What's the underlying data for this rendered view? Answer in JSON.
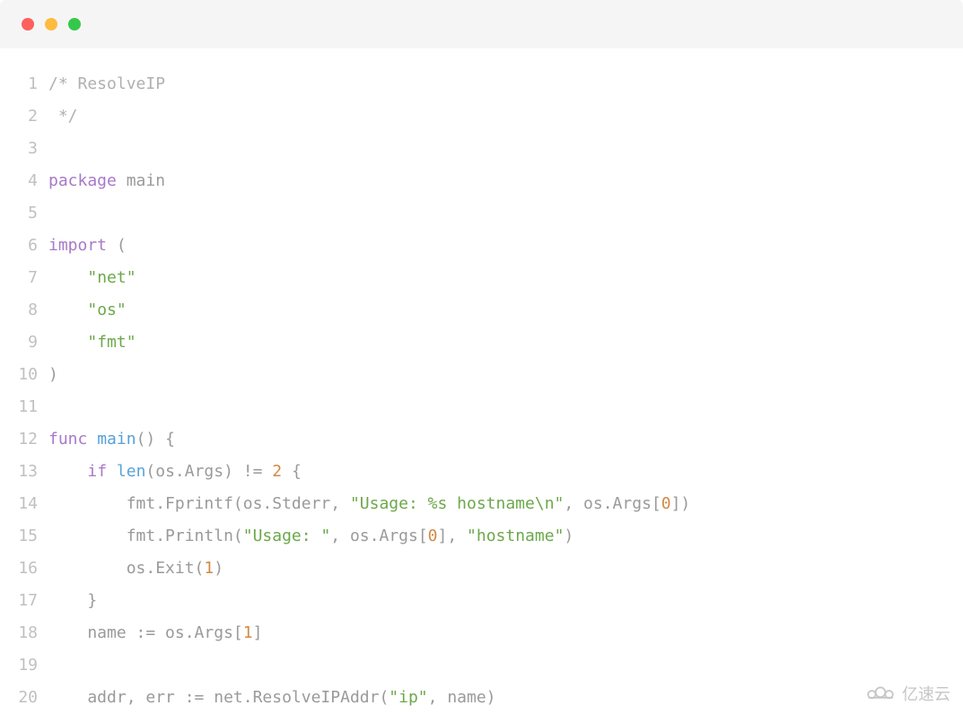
{
  "window": {
    "traffic_lights": [
      "red",
      "yellow",
      "green"
    ]
  },
  "code": {
    "language": "go",
    "lines": [
      {
        "n": 1,
        "tokens": [
          [
            "comment",
            "/* ResolveIP"
          ]
        ]
      },
      {
        "n": 2,
        "tokens": [
          [
            "comment",
            " */"
          ]
        ]
      },
      {
        "n": 3,
        "tokens": []
      },
      {
        "n": 4,
        "tokens": [
          [
            "keyword",
            "package"
          ],
          [
            "ident",
            " main"
          ]
        ]
      },
      {
        "n": 5,
        "tokens": []
      },
      {
        "n": 6,
        "tokens": [
          [
            "keyword",
            "import"
          ],
          [
            "punct",
            " ("
          ]
        ]
      },
      {
        "n": 7,
        "tokens": [
          [
            "ident",
            "    "
          ],
          [
            "string",
            "\"net\""
          ]
        ]
      },
      {
        "n": 8,
        "tokens": [
          [
            "ident",
            "    "
          ],
          [
            "string",
            "\"os\""
          ]
        ]
      },
      {
        "n": 9,
        "tokens": [
          [
            "ident",
            "    "
          ],
          [
            "string",
            "\"fmt\""
          ]
        ]
      },
      {
        "n": 10,
        "tokens": [
          [
            "punct",
            ")"
          ]
        ]
      },
      {
        "n": 11,
        "tokens": []
      },
      {
        "n": 12,
        "tokens": [
          [
            "keyword",
            "func"
          ],
          [
            "ident",
            " "
          ],
          [
            "fn",
            "main"
          ],
          [
            "punct",
            "()"
          ],
          [
            "punct",
            " {"
          ]
        ]
      },
      {
        "n": 13,
        "tokens": [
          [
            "ident",
            "    "
          ],
          [
            "keyword",
            "if"
          ],
          [
            "ident",
            " "
          ],
          [
            "builtin",
            "len"
          ],
          [
            "punct",
            "(os.Args) != "
          ],
          [
            "number",
            "2"
          ],
          [
            "punct",
            " {"
          ]
        ]
      },
      {
        "n": 14,
        "tokens": [
          [
            "ident",
            "        fmt.Fprintf(os.Stderr, "
          ],
          [
            "string",
            "\"Usage: %s hostname\\n\""
          ],
          [
            "ident",
            ", os.Args["
          ],
          [
            "number",
            "0"
          ],
          [
            "ident",
            "])"
          ]
        ]
      },
      {
        "n": 15,
        "tokens": [
          [
            "ident",
            "        fmt.Println("
          ],
          [
            "string",
            "\"Usage: \""
          ],
          [
            "ident",
            ", os.Args["
          ],
          [
            "number",
            "0"
          ],
          [
            "ident",
            "], "
          ],
          [
            "string",
            "\"hostname\""
          ],
          [
            "ident",
            ")"
          ]
        ]
      },
      {
        "n": 16,
        "tokens": [
          [
            "ident",
            "        os.Exit("
          ],
          [
            "number",
            "1"
          ],
          [
            "ident",
            ")"
          ]
        ]
      },
      {
        "n": 17,
        "tokens": [
          [
            "ident",
            "    }"
          ]
        ]
      },
      {
        "n": 18,
        "tokens": [
          [
            "ident",
            "    name := os.Args["
          ],
          [
            "number",
            "1"
          ],
          [
            "ident",
            "]"
          ]
        ]
      },
      {
        "n": 19,
        "tokens": []
      },
      {
        "n": 20,
        "tokens": [
          [
            "ident",
            "    addr, err := net.ResolveIPAddr("
          ],
          [
            "string",
            "\"ip\""
          ],
          [
            "ident",
            ", name)"
          ]
        ]
      }
    ]
  },
  "watermark": {
    "text": "亿速云"
  }
}
